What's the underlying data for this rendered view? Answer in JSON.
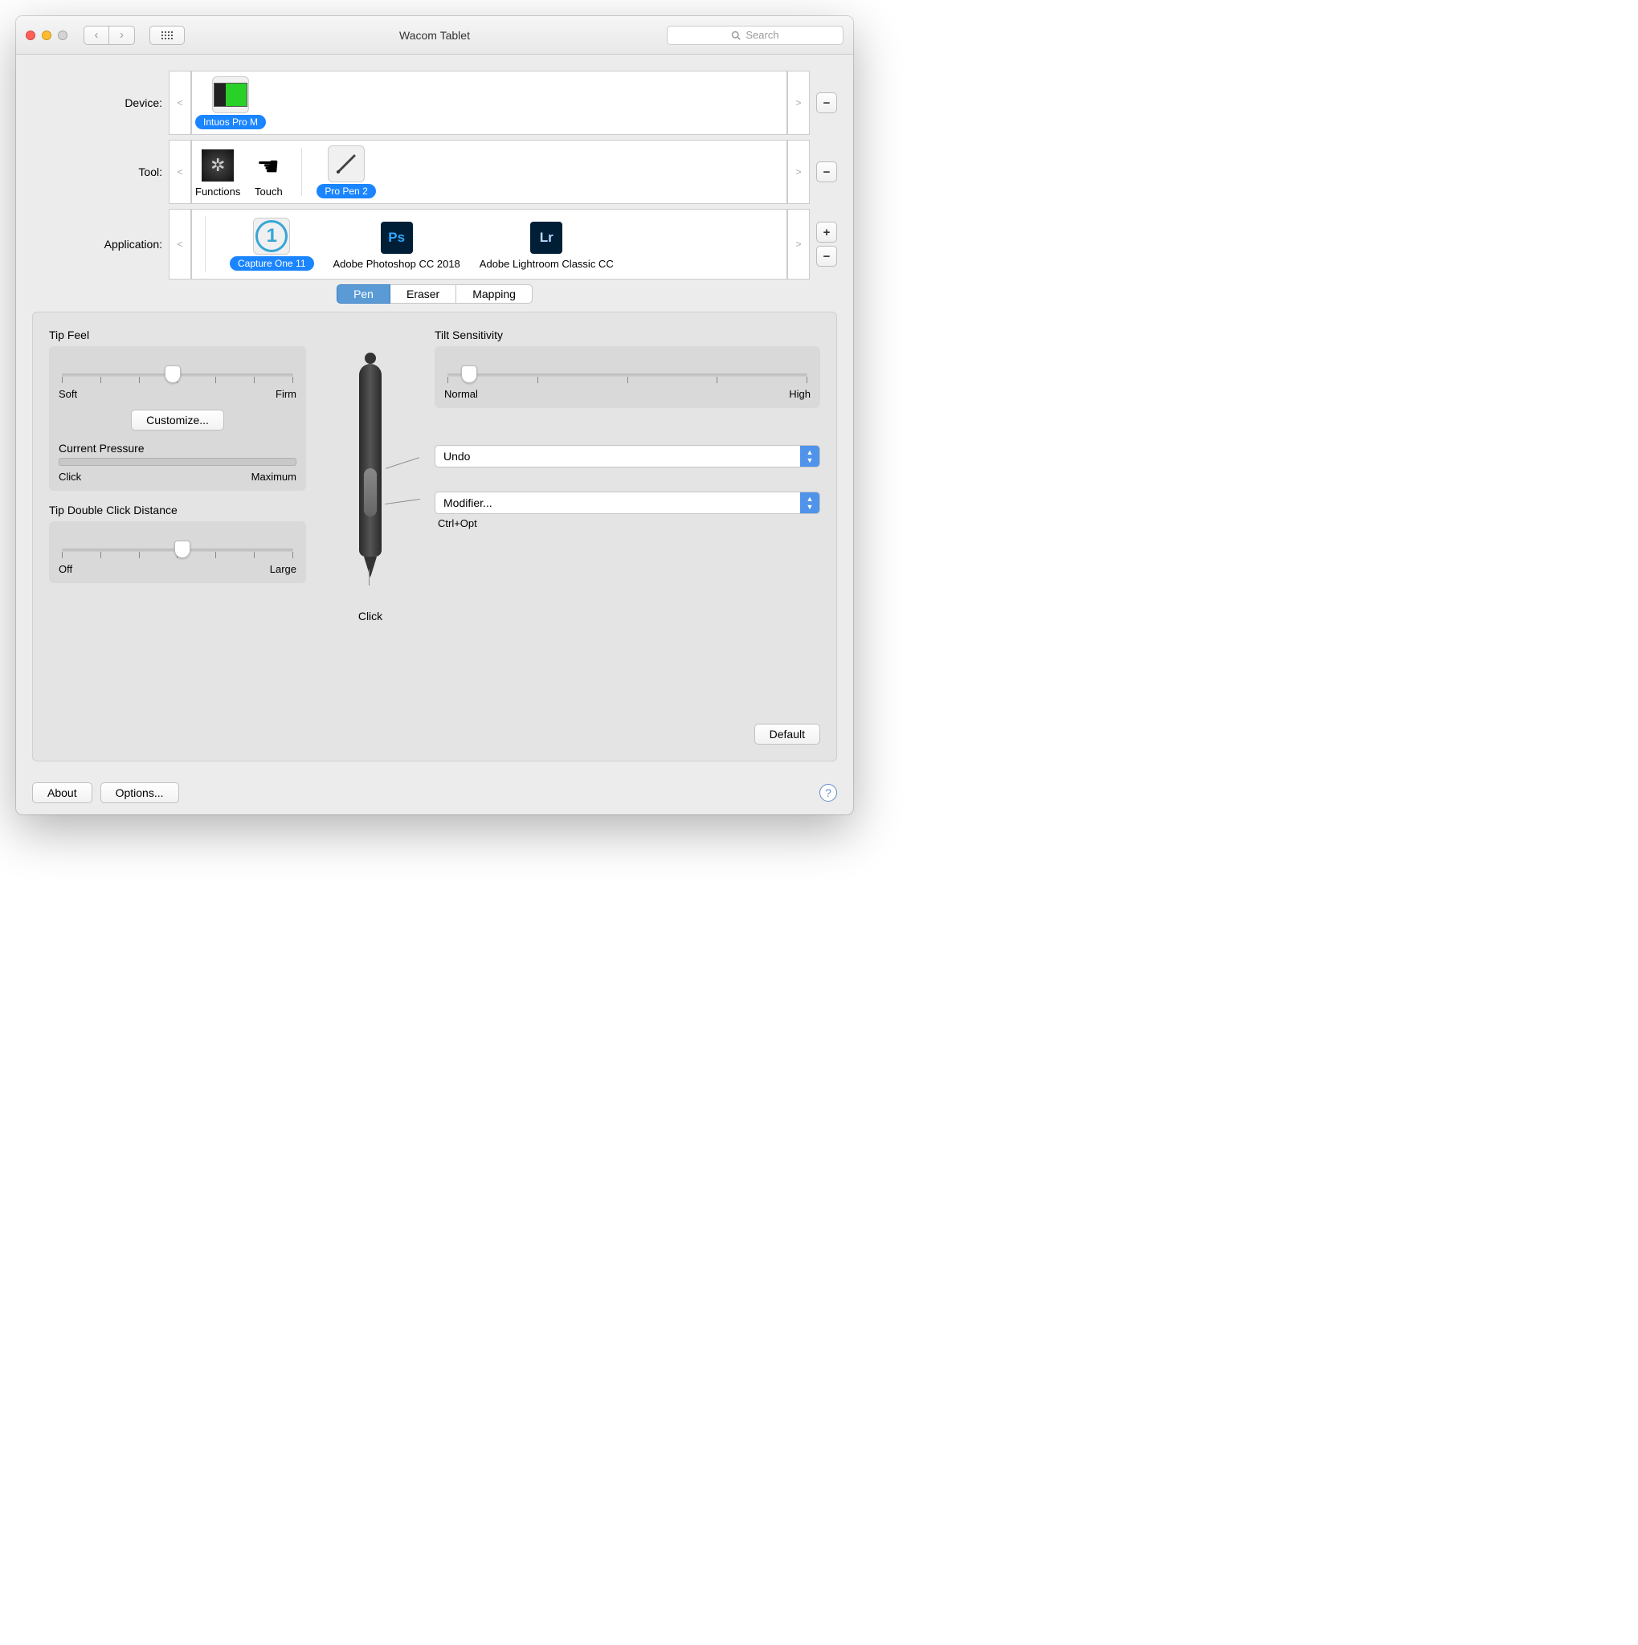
{
  "window": {
    "title": "Wacom Tablet",
    "search_placeholder": "Search"
  },
  "rows": {
    "device": {
      "label": "Device:",
      "items": [
        {
          "name": "Intuos Pro M",
          "selected": true
        }
      ]
    },
    "tool": {
      "label": "Tool:",
      "items": [
        {
          "name": "Functions",
          "selected": false
        },
        {
          "name": "Touch",
          "selected": false
        },
        {
          "name": "Pro Pen 2",
          "selected": true
        }
      ]
    },
    "application": {
      "label": "Application:",
      "items": [
        {
          "name": "Capture One 11",
          "selected": true
        },
        {
          "name": "Adobe Photoshop CC 2018",
          "selected": false
        },
        {
          "name": "Adobe Lightroom Classic CC",
          "selected": false
        }
      ]
    }
  },
  "tabs": {
    "pen": "Pen",
    "eraser": "Eraser",
    "mapping": "Mapping",
    "active": "pen"
  },
  "tip_feel": {
    "title": "Tip Feel",
    "left": "Soft",
    "right": "Firm",
    "customize": "Customize...",
    "value_pct": 48
  },
  "pressure": {
    "title": "Current Pressure",
    "left": "Click",
    "right": "Maximum"
  },
  "double_click": {
    "title": "Tip Double Click Distance",
    "left": "Off",
    "right": "Large",
    "value_pct": 52
  },
  "tilt": {
    "title": "Tilt Sensitivity",
    "left": "Normal",
    "right": "High",
    "value_pct": 6
  },
  "pen_buttons": {
    "upper": "Undo",
    "lower": "Modifier...",
    "lower_sub": "Ctrl+Opt",
    "tip": "Click"
  },
  "buttons": {
    "default": "Default",
    "about": "About",
    "options": "Options...",
    "minus": "−",
    "plus": "+",
    "back": "‹",
    "forward": "›"
  }
}
